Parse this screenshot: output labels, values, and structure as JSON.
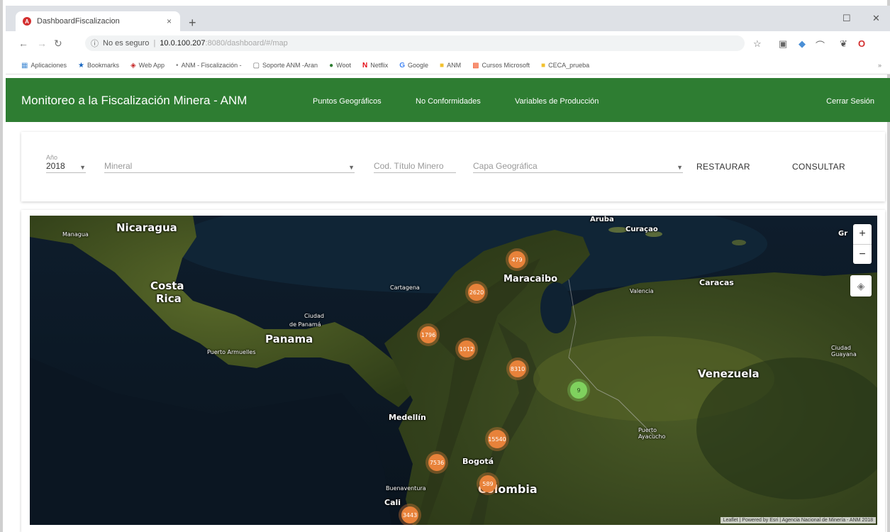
{
  "browser": {
    "tab_title": "DashboardFiscalizacion",
    "tab_close": "×",
    "new_tab": "+",
    "window_controls": [
      "☐",
      "✕"
    ],
    "url_warning": "No es seguro",
    "url_host": "10.0.100.207",
    "url_path": ":8080/dashboard/#/map",
    "bookmarks": [
      {
        "icon": "apps-grid-icon",
        "label": "Aplicaciones"
      },
      {
        "icon": "star-icon",
        "label": "Bookmarks"
      },
      {
        "icon": "web-icon",
        "label": "Web App"
      },
      {
        "icon": "dot-icon",
        "label": "ANM - Fiscalización -"
      },
      {
        "icon": "doc-icon",
        "label": "Soporte ANM -Aran"
      },
      {
        "icon": "woot-icon",
        "label": "Woot"
      },
      {
        "icon": "netflix-icon",
        "label": "Netflix"
      },
      {
        "icon": "google-icon",
        "label": "Google"
      },
      {
        "icon": "folder-icon",
        "label": "ANM"
      },
      {
        "icon": "microsoft-icon",
        "label": "Cursos Microsoft"
      },
      {
        "icon": "folder-icon",
        "label": "CECA_prueba"
      }
    ]
  },
  "header": {
    "brand": "Monitoreo a la Fiscalización Minera - ANM",
    "nav": [
      "Puntos Geográficos",
      "No Conformidades",
      "Variables de Producción"
    ],
    "logout": "Cerrar Sesión",
    "color": "#2e7d32"
  },
  "filters": {
    "year_label": "Año",
    "year_value": "2018",
    "mineral_placeholder": "Mineral",
    "titulo_placeholder": "Cod. Título Minero",
    "capa_placeholder": "Capa Geográfica",
    "restore_label": "RESTAURAR",
    "query_label": "CONSULTAR"
  },
  "map": {
    "places": [
      {
        "name": "Nicaragua",
        "size": "big"
      },
      {
        "name": "Managua",
        "size": "sm"
      },
      {
        "name": "Costa",
        "size": "big"
      },
      {
        "name": "Rica",
        "size": "big"
      },
      {
        "name": "Panama",
        "size": "big"
      },
      {
        "name": "Ciudad",
        "size": "sm"
      },
      {
        "name": "de Panamá",
        "size": "sm"
      },
      {
        "name": "Puerto Armuelles",
        "size": "sm"
      },
      {
        "name": "Cartagena",
        "size": "sm"
      },
      {
        "name": "Maracaibo",
        "size": "med"
      },
      {
        "name": "Aruba",
        "size": "med"
      },
      {
        "name": "Curaçao",
        "size": "med"
      },
      {
        "name": "Caracas",
        "size": "med"
      },
      {
        "name": "Valencia",
        "size": "sm"
      },
      {
        "name": "Venezuela",
        "size": "big"
      },
      {
        "name": "Ciudad Guayana",
        "size": "sm"
      },
      {
        "name": "Medellín",
        "size": "med"
      },
      {
        "name": "Bogotá",
        "size": "med"
      },
      {
        "name": "Colombia",
        "size": "big"
      },
      {
        "name": "Buenaventura",
        "size": "sm"
      },
      {
        "name": "Cali",
        "size": "med"
      },
      {
        "name": "Puerto Ayacucho",
        "size": "sm"
      },
      {
        "name": "Gr",
        "size": "med"
      }
    ],
    "clusters": [
      {
        "count": "479",
        "color": "orange"
      },
      {
        "count": "2620",
        "color": "orange"
      },
      {
        "count": "1796",
        "color": "orange"
      },
      {
        "count": "1012",
        "color": "orange"
      },
      {
        "count": "8310",
        "color": "orange"
      },
      {
        "count": "9",
        "color": "green"
      },
      {
        "count": "15540",
        "color": "orange"
      },
      {
        "count": "7536",
        "color": "orange"
      },
      {
        "count": "589",
        "color": "orange"
      },
      {
        "count": "3443",
        "color": "orange"
      }
    ],
    "zoom_in": "+",
    "zoom_out": "−",
    "attribution": "Leaflet | Powered by Esri | Agencia Nacional de Minería - ANM 2018"
  }
}
